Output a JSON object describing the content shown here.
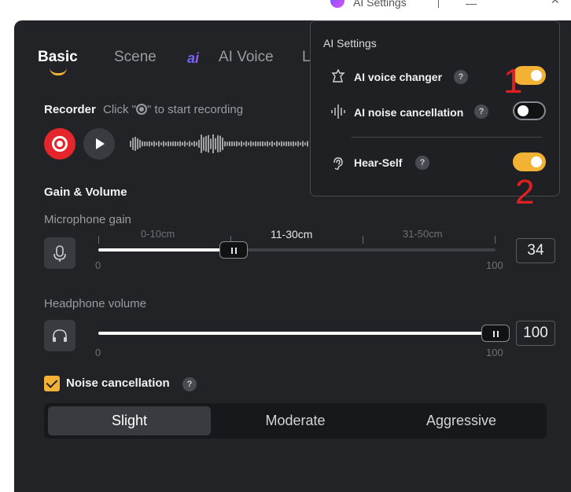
{
  "window": {
    "title": "AI Settings"
  },
  "tabs": [
    {
      "label": "Basic",
      "active": true
    },
    {
      "label": "Scene",
      "active": false
    },
    {
      "label": "AI Voice",
      "active": false
    },
    {
      "label": "L",
      "active": false
    }
  ],
  "recorder": {
    "title": "Recorder",
    "hint_before": "Click \"",
    "hint_after": "\" to start recording"
  },
  "gain_volume": {
    "title": "Gain & Volume",
    "microphone": {
      "label": "Microphone gain",
      "zones": [
        "0-10cm",
        "11-30cm",
        "31-50cm"
      ],
      "active_zone": "11-30cm",
      "min": "0",
      "max": "100",
      "value": "34"
    },
    "headphone": {
      "label": "Headphone volume",
      "min": "0",
      "max": "100",
      "value": "100"
    }
  },
  "noise_cancellation": {
    "label": "Noise cancellation",
    "checked": true,
    "help": "?",
    "levels": [
      "Slight",
      "Moderate",
      "Aggressive"
    ],
    "selected": "Slight"
  },
  "ai_settings_popup": {
    "title": "AI Settings",
    "rows": [
      {
        "label": "AI voice changer",
        "help": "?",
        "enabled": true
      },
      {
        "label": "AI noise cancellation",
        "help": "?",
        "enabled": false
      },
      {
        "label": "Hear-Self",
        "help": "?",
        "enabled": true
      }
    ]
  },
  "annotations": [
    "1",
    "2"
  ],
  "colors": {
    "accent": "#f3b233",
    "record": "#e4262c",
    "panel_bg": "#222327",
    "annotation": "#e02020"
  }
}
